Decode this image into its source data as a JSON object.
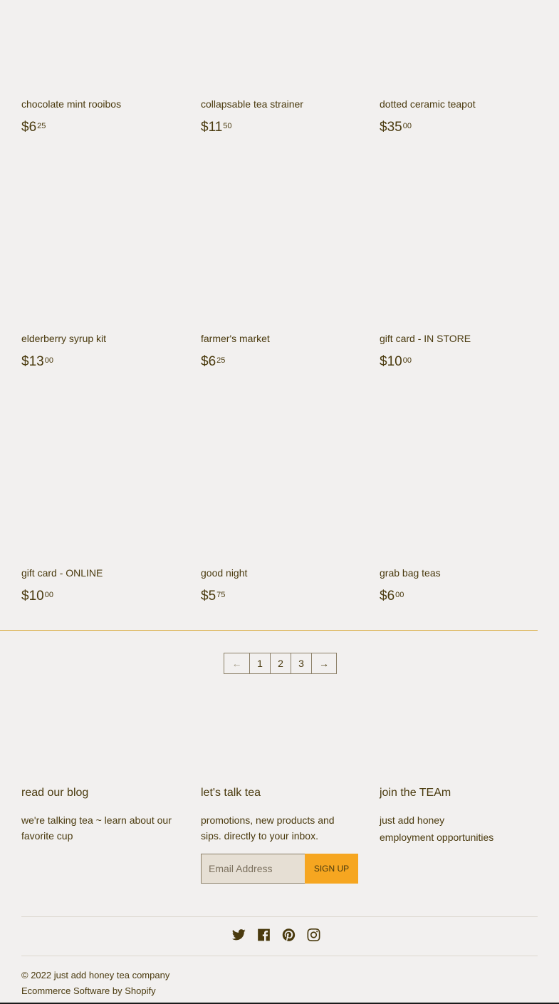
{
  "products": [
    {
      "title": "chocolate mint rooibos",
      "price_dollars": "$6",
      "price_cents": "25"
    },
    {
      "title": "collapsable tea strainer",
      "price_dollars": "$11",
      "price_cents": "50"
    },
    {
      "title": "dotted ceramic teapot",
      "price_dollars": "$35",
      "price_cents": "00"
    },
    {
      "title": "elderberry syrup kit",
      "price_dollars": "$13",
      "price_cents": "00"
    },
    {
      "title": "farmer's market",
      "price_dollars": "$6",
      "price_cents": "25"
    },
    {
      "title": "gift card - IN STORE",
      "price_dollars": "$10",
      "price_cents": "00"
    },
    {
      "title": "gift card - ONLINE",
      "price_dollars": "$10",
      "price_cents": "00"
    },
    {
      "title": "good night",
      "price_dollars": "$5",
      "price_cents": "75"
    },
    {
      "title": "grab bag teas",
      "price_dollars": "$6",
      "price_cents": "00"
    }
  ],
  "pagination": {
    "prev": "←",
    "pages": [
      "1",
      "2",
      "3"
    ],
    "next": "→"
  },
  "footer": {
    "blog": {
      "heading": "read our blog",
      "text": "we're talking tea ~ learn about our favorite cup"
    },
    "newsletter": {
      "heading": "let's talk tea",
      "text": "promotions, new products and sips. directly to your inbox.",
      "email_placeholder": "Email Address",
      "signup_label": "SIGN UP"
    },
    "team": {
      "heading": "join the TEAm",
      "links": [
        "just add honey",
        "employment opportunities"
      ]
    },
    "social_icons": [
      "twitter-icon",
      "facebook-icon",
      "pinterest-icon",
      "instagram-icon"
    ],
    "copyright": "© 2022 just add honey tea company",
    "powered_by": "Ecommerce Software by Shopify"
  },
  "colors": {
    "background": "#f2f0ef",
    "text": "#4a3a0e",
    "accent": "#f6a620",
    "divider": "#d9a93b"
  }
}
